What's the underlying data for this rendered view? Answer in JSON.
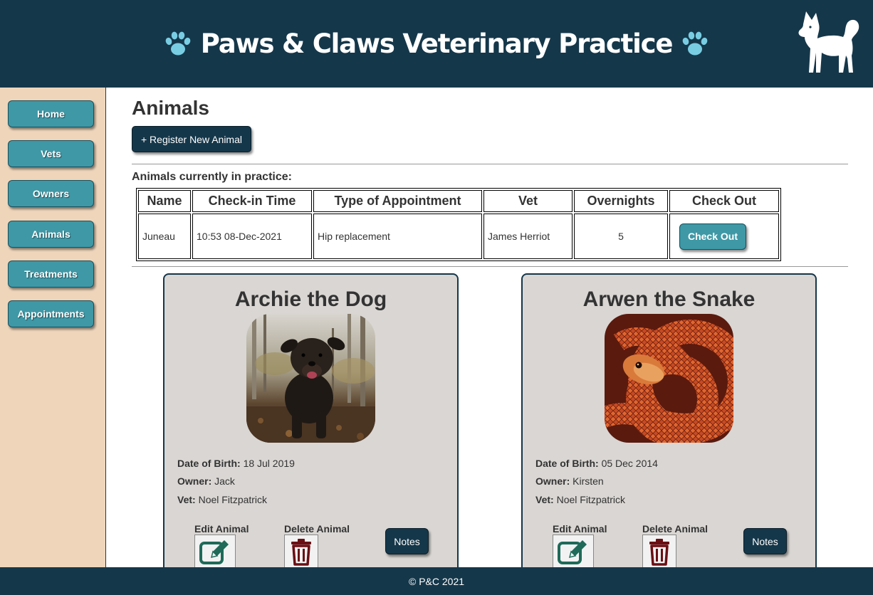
{
  "header": {
    "title": "Paws & Claws Veterinary Practice"
  },
  "sidebar": {
    "items": [
      {
        "label": "Home"
      },
      {
        "label": "Vets"
      },
      {
        "label": "Owners"
      },
      {
        "label": "Animals"
      },
      {
        "label": "Treatments"
      },
      {
        "label": "Appointments"
      }
    ]
  },
  "main": {
    "title": "Animals",
    "register_label": "+ Register New Animal",
    "table_caption": "Animals currently in practice:",
    "table": {
      "headers": [
        "Name",
        "Check-in Time",
        "Type of Appointment",
        "Vet",
        "Overnights",
        "Check Out"
      ],
      "rows": [
        {
          "name": "Juneau",
          "checkin": "10:53 08-Dec-2021",
          "appointment": "Hip replacement",
          "vet": "James Herriot",
          "overnights": "5",
          "checkout_label": "Check Out"
        }
      ]
    },
    "cards": [
      {
        "title": "Archie the Dog",
        "dob_label": "Date of Birth:",
        "dob": "18 Jul 2019",
        "owner_label": "Owner:",
        "owner": "Jack",
        "vet_label": "Vet:",
        "vet": "Noel Fitzpatrick",
        "edit_label": "Edit Animal",
        "delete_label": "Delete Animal",
        "notes_label": "Notes"
      },
      {
        "title": "Arwen the Snake",
        "dob_label": "Date of Birth:",
        "dob": "05 Dec 2014",
        "owner_label": "Owner:",
        "owner": "Kirsten",
        "vet_label": "Vet:",
        "vet": "Noel Fitzpatrick",
        "edit_label": "Edit Animal",
        "delete_label": "Delete Animal",
        "notes_label": "Notes"
      }
    ]
  },
  "footer": {
    "text": "© P&C 2021"
  },
  "colors": {
    "header": "#15374a",
    "sidebar": "#efd6bb",
    "accent": "#3f98a6",
    "card": "#d9d6d3",
    "paw": "#79cde3"
  },
  "icons": [
    "paw-icon",
    "dog-logo-icon",
    "edit-icon",
    "trash-icon"
  ]
}
